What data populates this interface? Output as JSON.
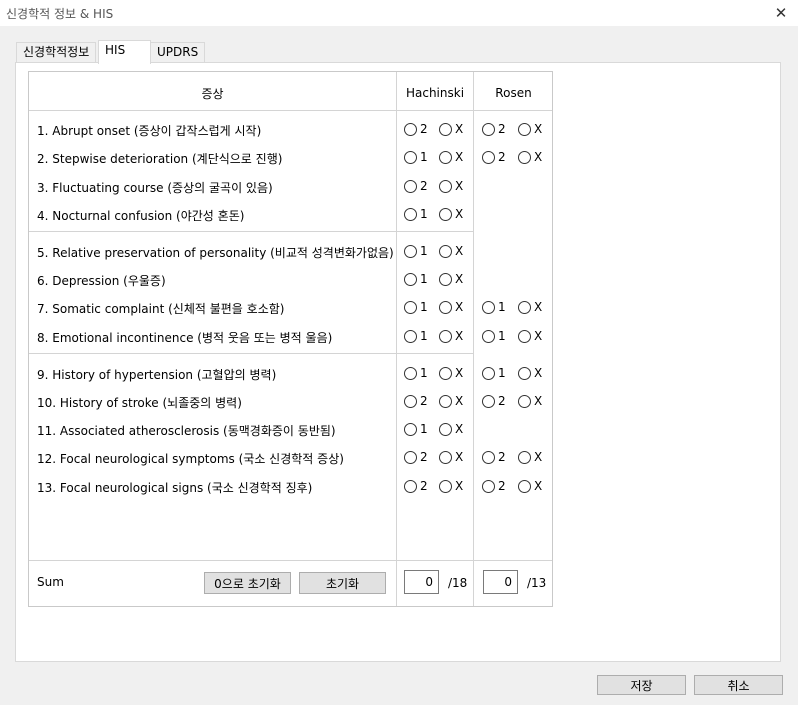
{
  "window": {
    "title": "신경학적 정보 & HIS"
  },
  "tabs": [
    {
      "label": "신경학적정보"
    },
    {
      "label": "HIS"
    },
    {
      "label": "UPDRS"
    }
  ],
  "table": {
    "headers": {
      "symptom": "증상",
      "hachinski": "Hachinski",
      "rosen": "Rosen"
    },
    "rows": [
      {
        "label": "1. Abrupt onset (증상이 갑작스럽게 시작)",
        "h": "2",
        "r": "2"
      },
      {
        "label": "2. Stepwise deterioration (계단식으로 진행)",
        "h": "1",
        "r": "2"
      },
      {
        "label": "3. Fluctuating course (증상의 굴곡이 있음)",
        "h": "2",
        "r": null
      },
      {
        "label": "4. Nocturnal confusion (야간성 혼돈)",
        "h": "1",
        "r": null
      },
      {
        "label": "5. Relative preservation of personality (비교적 성격변화가없음)",
        "h": "1",
        "r": null
      },
      {
        "label": "6. Depression (우울증)",
        "h": "1",
        "r": null
      },
      {
        "label": "7. Somatic complaint (신체적 불편을 호소함)",
        "h": "1",
        "r": "1"
      },
      {
        "label": "8. Emotional incontinence (병적 웃음 또는 병적 울음)",
        "h": "1",
        "r": "1"
      },
      {
        "label": "9. History of hypertension (고혈압의 병력)",
        "h": "1",
        "r": "1"
      },
      {
        "label": "10. History of stroke (뇌졸중의 병력)",
        "h": "2",
        "r": "2"
      },
      {
        "label": "11. Associated atherosclerosis (동맥경화증이 동반됨)",
        "h": "1",
        "r": null
      },
      {
        "label": "12. Focal neurological symptoms (국소 신경학적 증상)",
        "h": "2",
        "r": "2"
      },
      {
        "label": "13. Focal neurological signs (국소 신경학적 징후)",
        "h": "2",
        "r": "2"
      }
    ],
    "no_label": "X"
  },
  "sum": {
    "label": "Sum",
    "reset_zero_label": "0으로 초기화",
    "reset_label": "초기화",
    "hachinski_value": "0",
    "hachinski_max": "/18",
    "rosen_value": "0",
    "rosen_max": "/13"
  },
  "footer": {
    "save_label": "저장",
    "cancel_label": "취소"
  },
  "icons": {
    "close": "close-icon",
    "radio": "radio-circle-icon"
  }
}
